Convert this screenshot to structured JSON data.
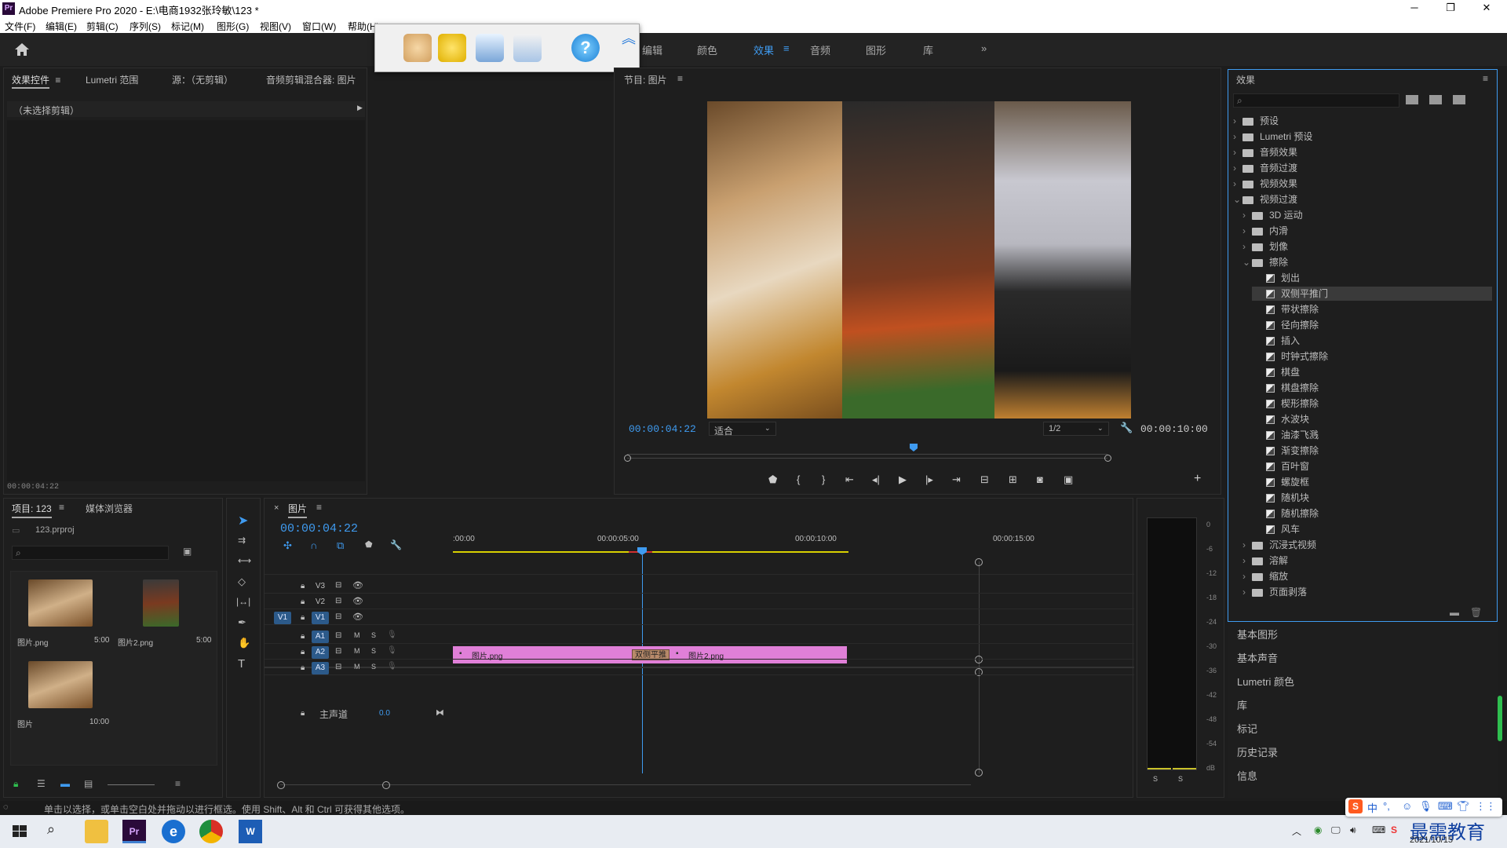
{
  "window": {
    "app_icon": "Pr",
    "title": "Adobe Premiere Pro 2020 - E:\\电商1932张玲敏\\123 *",
    "min_icon": "minimize-icon",
    "max_icon": "maximize-icon",
    "close_icon": "close-icon"
  },
  "menu": [
    "文件(F)",
    "编辑(E)",
    "剪辑(C)",
    "序列(S)",
    "标记(M)",
    "图形(G)",
    "视图(V)",
    "窗口(W)",
    "帮助(H)"
  ],
  "workspace_tabs": [
    "编辑",
    "颜色",
    "效果",
    "音频",
    "图形",
    "库"
  ],
  "workspace_active": "效果",
  "source_panel": {
    "tabs": [
      "效果控件",
      "Lumetri 范围",
      "源：（无剪辑）",
      "音频剪辑混合器: 图片"
    ],
    "no_clip": "（未选择剪辑）",
    "timecode": "00:00:04:22"
  },
  "program_monitor": {
    "title": "节目: 图片",
    "timecode_current": "00:00:04:22",
    "fit": "适合",
    "resolution": "1/2",
    "timecode_total": "00:00:10:00"
  },
  "project_panel": {
    "tabs": [
      "项目: 123",
      "媒体浏览器"
    ],
    "project_file": "123.prproj",
    "items": [
      {
        "name": "图片.png",
        "duration": "5:00"
      },
      {
        "name": "图片2.png",
        "duration": "5:00"
      },
      {
        "name": "图片",
        "duration": "10:00"
      }
    ]
  },
  "timeline": {
    "title": "图片",
    "timecode": "00:00:04:22",
    "ruler": [
      ":00:00",
      "00:00:05:00",
      "00:00:10:00",
      "00:00:15:00"
    ],
    "tracks": [
      "V3",
      "V2",
      "V1",
      "A1",
      "A2",
      "A3"
    ],
    "master_label": "主声道",
    "master_value": "0.0",
    "clip1": "图片.png",
    "clip2": "图片2.png",
    "transition": "双侧平推"
  },
  "effects_panel": {
    "title": "效果",
    "tree": [
      {
        "label": "预设",
        "level": 0,
        "type": "folder"
      },
      {
        "label": "Lumetri 预设",
        "level": 0,
        "type": "folder"
      },
      {
        "label": "音频效果",
        "level": 0,
        "type": "folder"
      },
      {
        "label": "音频过渡",
        "level": 0,
        "type": "folder"
      },
      {
        "label": "视频效果",
        "level": 0,
        "type": "folder"
      },
      {
        "label": "视频过渡",
        "level": 0,
        "type": "folder-open"
      },
      {
        "label": "3D 运动",
        "level": 1,
        "type": "folder"
      },
      {
        "label": "内滑",
        "level": 1,
        "type": "folder"
      },
      {
        "label": "划像",
        "level": 1,
        "type": "folder"
      },
      {
        "label": "擦除",
        "level": 1,
        "type": "folder-open"
      },
      {
        "label": "划出",
        "level": 2,
        "type": "fx"
      },
      {
        "label": "双侧平推门",
        "level": 2,
        "type": "fx",
        "selected": true
      },
      {
        "label": "带状擦除",
        "level": 2,
        "type": "fx"
      },
      {
        "label": "径向擦除",
        "level": 2,
        "type": "fx"
      },
      {
        "label": "插入",
        "level": 2,
        "type": "fx"
      },
      {
        "label": "时钟式擦除",
        "level": 2,
        "type": "fx"
      },
      {
        "label": "棋盘",
        "level": 2,
        "type": "fx"
      },
      {
        "label": "棋盘擦除",
        "level": 2,
        "type": "fx"
      },
      {
        "label": "楔形擦除",
        "level": 2,
        "type": "fx"
      },
      {
        "label": "水波块",
        "level": 2,
        "type": "fx"
      },
      {
        "label": "油漆飞溅",
        "level": 2,
        "type": "fx"
      },
      {
        "label": "渐变擦除",
        "level": 2,
        "type": "fx"
      },
      {
        "label": "百叶窗",
        "level": 2,
        "type": "fx"
      },
      {
        "label": "螺旋框",
        "level": 2,
        "type": "fx"
      },
      {
        "label": "随机块",
        "level": 2,
        "type": "fx"
      },
      {
        "label": "随机擦除",
        "level": 2,
        "type": "fx"
      },
      {
        "label": "风车",
        "level": 2,
        "type": "fx"
      },
      {
        "label": "沉浸式视频",
        "level": 1,
        "type": "folder"
      },
      {
        "label": "溶解",
        "level": 1,
        "type": "folder"
      },
      {
        "label": "缩放",
        "level": 1,
        "type": "folder"
      },
      {
        "label": "页面剥落",
        "level": 1,
        "type": "folder"
      }
    ]
  },
  "right_panels": [
    "基本图形",
    "基本声音",
    "Lumetri 颜色",
    "库",
    "标记",
    "历史记录",
    "信息"
  ],
  "meter_scale": [
    "0",
    "-6",
    "-12",
    "-18",
    "-24",
    "-30",
    "-36",
    "-42",
    "-48",
    "-54",
    "dB"
  ],
  "status": "单击以选择，或单击空白处并拖动以进行框选。使用 Shift、Alt 和 Ctrl 可获得其他选项。",
  "taskbar": {
    "date": "2021/10/15",
    "watermark": "最需教育"
  }
}
